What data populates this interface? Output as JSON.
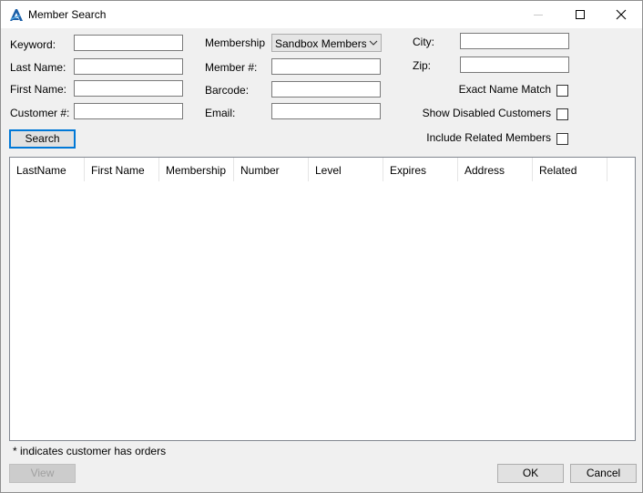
{
  "window": {
    "title": "Member Search",
    "icons": {
      "app": "app-logo-icon",
      "minimize": "minimize-icon",
      "maximize": "maximize-icon",
      "close": "close-icon"
    }
  },
  "form": {
    "keyword": {
      "label": "Keyword:",
      "value": ""
    },
    "last_name": {
      "label": "Last Name:",
      "value": ""
    },
    "first_name": {
      "label": "First Name:",
      "value": ""
    },
    "customer_no": {
      "label": "Customer #:",
      "value": ""
    },
    "membership": {
      "label": "Membership",
      "selected": "Sandbox Membership"
    },
    "member_no": {
      "label": "Member #:",
      "value": ""
    },
    "barcode": {
      "label": "Barcode:",
      "value": ""
    },
    "email": {
      "label": "Email:",
      "value": ""
    },
    "city": {
      "label": "City:",
      "value": ""
    },
    "zip": {
      "label": "Zip:",
      "value": ""
    },
    "exact_name_match": {
      "label": "Exact Name Match",
      "checked": false
    },
    "show_disabled": {
      "label": "Show Disabled Customers",
      "checked": false
    },
    "include_related": {
      "label": "Include Related Members",
      "checked": false
    },
    "search_button": "Search"
  },
  "grid": {
    "columns": [
      "LastName",
      "First Name",
      "Membership",
      "Number",
      "Level",
      "Expires",
      "Address",
      "Related"
    ],
    "rows": []
  },
  "footer": {
    "note": "* indicates customer has orders",
    "view_button": "View",
    "ok_button": "OK",
    "cancel_button": "Cancel"
  }
}
